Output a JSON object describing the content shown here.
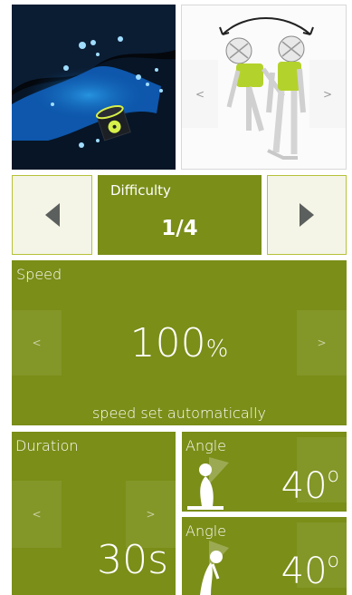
{
  "preview": {
    "nav_prev": "<",
    "nav_next": ">"
  },
  "difficulty": {
    "label": "Difficulty",
    "value": "1/4"
  },
  "speed": {
    "label": "Speed",
    "value": "100",
    "unit": "%",
    "note": "speed set automatically",
    "prev": "<",
    "next": ">"
  },
  "duration": {
    "label": "Duration",
    "value": "30s",
    "prev": "<",
    "next": ">"
  },
  "angle_1": {
    "label": "Angle",
    "value": "40",
    "unit": "o"
  },
  "angle_2": {
    "label": "Angle",
    "value": "40",
    "unit": "o"
  },
  "colors": {
    "accent": "#7a8e18",
    "light_bg": "#f4f5e6",
    "border": "#b6c23a",
    "figure_green": "#b4d22c",
    "game_blue": "#1aa6ff"
  }
}
